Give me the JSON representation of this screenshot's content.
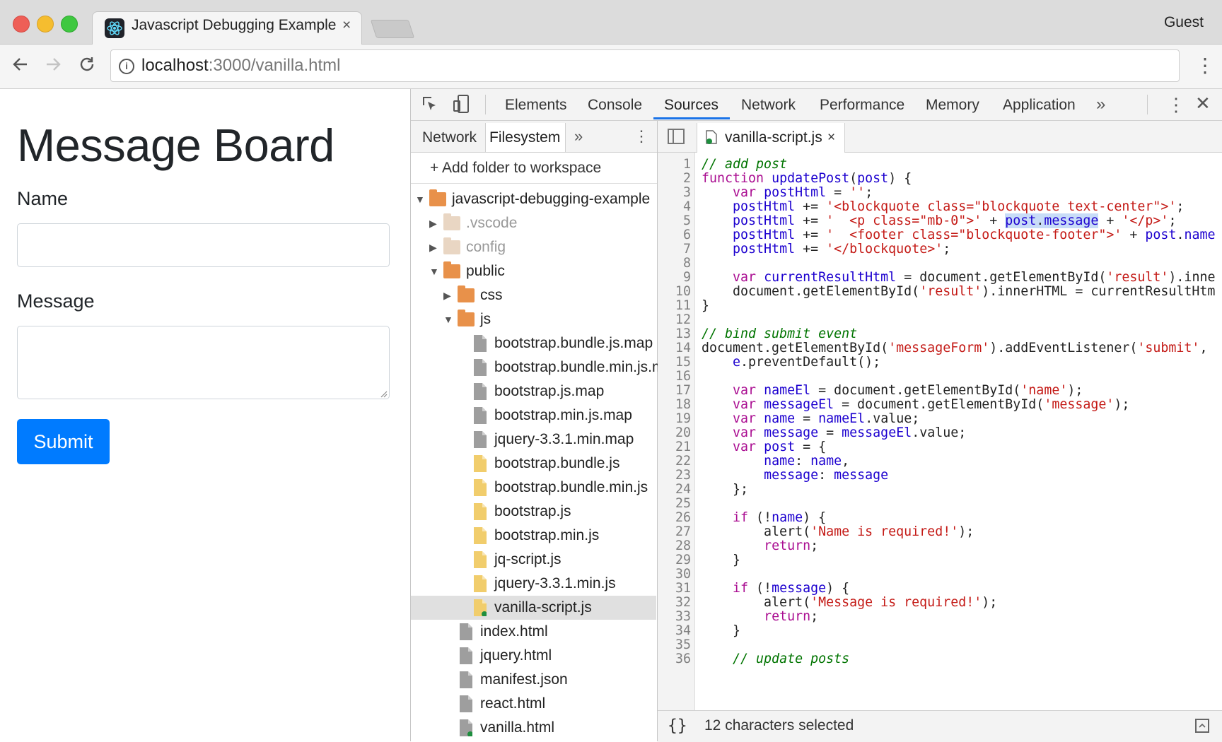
{
  "browser": {
    "tab_title": "Javascript Debugging Example",
    "tab_close": "×",
    "profile": "Guest",
    "url_host": "localhost",
    "url_path": ":3000/vanilla.html"
  },
  "page": {
    "title": "Message Board",
    "name_label": "Name",
    "message_label": "Message",
    "name_value": "",
    "message_value": "",
    "submit_label": "Submit",
    "accent": "#007bff"
  },
  "devtools": {
    "tabs": [
      "Elements",
      "Console",
      "Sources",
      "Network",
      "Performance",
      "Memory",
      "Application"
    ],
    "active_tab": "Sources",
    "more": "»",
    "close": "✕",
    "navigator": {
      "tabs": [
        "Network",
        "Filesystem"
      ],
      "active_tab": "Filesystem",
      "more": "»",
      "add_folder": "+ Add folder to workspace",
      "tree": [
        {
          "label": "javascript-debugging-example",
          "kind": "folder",
          "color": "#e8914a"
        },
        {
          "label": ".vscode",
          "kind": "folder",
          "color": "#e9d6c3",
          "muted": true
        },
        {
          "label": "config",
          "kind": "folder",
          "color": "#e9d6c3",
          "muted": true
        },
        {
          "label": "public",
          "kind": "folder",
          "color": "#e8914a"
        },
        {
          "label": "css",
          "kind": "folder",
          "color": "#e8914a"
        },
        {
          "label": "js",
          "kind": "folder",
          "color": "#e8914a"
        },
        {
          "label": "bootstrap.bundle.js.map",
          "kind": "file",
          "color": "#9e9e9e"
        },
        {
          "label": "bootstrap.bundle.min.js.map",
          "kind": "file",
          "color": "#9e9e9e"
        },
        {
          "label": "bootstrap.js.map",
          "kind": "file",
          "color": "#9e9e9e"
        },
        {
          "label": "bootstrap.min.js.map",
          "kind": "file",
          "color": "#9e9e9e"
        },
        {
          "label": "jquery-3.3.1.min.map",
          "kind": "file",
          "color": "#9e9e9e"
        },
        {
          "label": "bootstrap.bundle.js",
          "kind": "file",
          "color": "#f1cd6c"
        },
        {
          "label": "bootstrap.bundle.min.js",
          "kind": "file",
          "color": "#f1cd6c"
        },
        {
          "label": "bootstrap.js",
          "kind": "file",
          "color": "#f1cd6c"
        },
        {
          "label": "bootstrap.min.js",
          "kind": "file",
          "color": "#f1cd6c"
        },
        {
          "label": "jq-script.js",
          "kind": "file",
          "color": "#f1cd6c"
        },
        {
          "label": "jquery-3.3.1.min.js",
          "kind": "file",
          "color": "#f1cd6c"
        },
        {
          "label": "vanilla-script.js",
          "kind": "file",
          "color": "#f1cd6c",
          "selected": true,
          "mapped": true
        },
        {
          "label": "index.html",
          "kind": "file",
          "color": "#9e9e9e"
        },
        {
          "label": "jquery.html",
          "kind": "file",
          "color": "#9e9e9e"
        },
        {
          "label": "manifest.json",
          "kind": "file",
          "color": "#9e9e9e"
        },
        {
          "label": "react.html",
          "kind": "file",
          "color": "#9e9e9e"
        },
        {
          "label": "vanilla.html",
          "kind": "file",
          "color": "#9e9e9e",
          "mapped": true
        }
      ]
    },
    "editor": {
      "tab_label": "vanilla-script.js",
      "tab_close": "×",
      "lines": [
        "// add post",
        "function updatePost(post) {",
        "    var postHtml = '';",
        "    postHtml += '<blockquote class=\"blockquote text-center\">';",
        "    postHtml += '  <p class=\"mb-0\">' + post.message + '</p>';",
        "    postHtml += '  <footer class=\"blockquote-footer\">' + post.name",
        "    postHtml += '</blockquote>';",
        "",
        "    var currentResultHtml = document.getElementById('result').inne",
        "    document.getElementById('result').innerHTML = currentResultHtm",
        "}",
        "",
        "// bind submit event",
        "document.getElementById('messageForm').addEventListener('submit',",
        "    e.preventDefault();",
        "",
        "    var nameEl = document.getElementById('name');",
        "    var messageEl = document.getElementById('message');",
        "    var name = nameEl.value;",
        "    var message = messageEl.value;",
        "    var post = {",
        "        name: name,",
        "        message: message",
        "    };",
        "",
        "    if (!name) {",
        "        alert('Name is required!');",
        "        return;",
        "    }",
        "",
        "    if (!message) {",
        "        alert('Message is required!');",
        "        return;",
        "    }",
        "",
        "    // update posts"
      ],
      "selection": "post.message"
    },
    "status": {
      "pretty_print": "{}",
      "text": "12 characters selected"
    }
  }
}
